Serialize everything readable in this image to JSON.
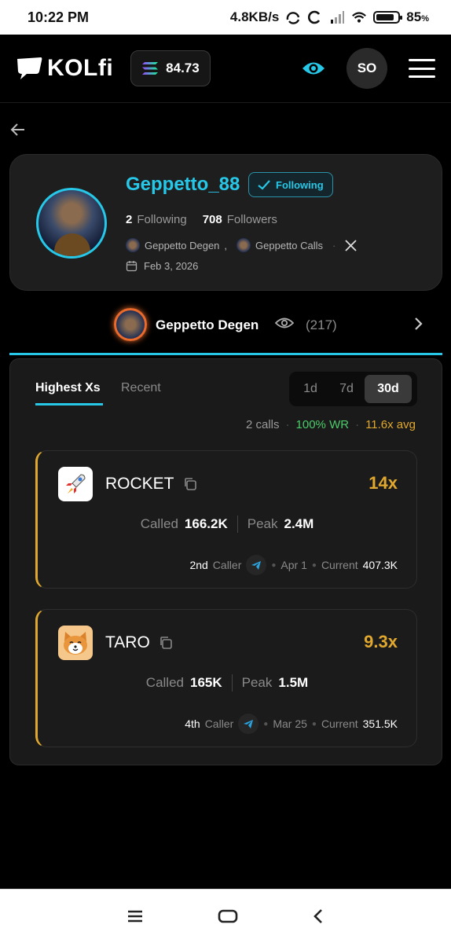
{
  "status_bar": {
    "time": "10:22 PM",
    "network_speed": "4.8KB/s",
    "battery": "85",
    "battery_unit": "%"
  },
  "header": {
    "logo_text": "KOLfi",
    "balance": "84.73",
    "avatar_initials": "SO"
  },
  "profile": {
    "name": "Geppetto_88",
    "following_badge": "Following",
    "following_count": "2",
    "following_label": "Following",
    "followers_count": "708",
    "followers_label": "Followers",
    "linked_1": "Geppetto Degen",
    "linked_sep": ",",
    "linked_2": "Geppetto Calls",
    "joined": "Feb 3, 2026"
  },
  "channel": {
    "name": "Geppetto Degen",
    "viewers": "(217)"
  },
  "tabs": {
    "highest": "Highest Xs",
    "recent": "Recent"
  },
  "range": {
    "d1": "1d",
    "d7": "7d",
    "d30": "30d",
    "selected": "30d"
  },
  "summary": {
    "calls": "2 calls",
    "wr": "100% WR",
    "avg": "11.6x avg"
  },
  "calls": [
    {
      "token": "ROCKET",
      "icon": "rocket-icon",
      "multiplier": "14x",
      "called_label": "Called",
      "called": "166.2K",
      "peak_label": "Peak",
      "peak": "2.4M",
      "rank": "2nd",
      "caller_label": "Caller",
      "date": "Apr 1",
      "current_label": "Current",
      "current": "407.3K"
    },
    {
      "token": "TARO",
      "icon": "shiba-icon",
      "multiplier": "9.3x",
      "called_label": "Called",
      "called": "165K",
      "peak_label": "Peak",
      "peak": "1.5M",
      "rank": "4th",
      "caller_label": "Caller",
      "date": "Mar 25",
      "current_label": "Current",
      "current": "351.5K"
    }
  ],
  "colors": {
    "accent": "#27c7e8",
    "gold": "#e0a82e",
    "green": "#4ccc6a"
  }
}
